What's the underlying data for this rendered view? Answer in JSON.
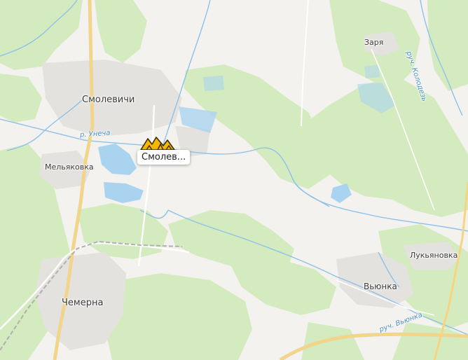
{
  "map": {
    "places": {
      "smolevichi": "Смолевичи",
      "melyakovka": "Мельяковка",
      "chemerna": "Чемерна",
      "zarya": "Заря",
      "vyunka": "Вьюнка",
      "lukyanovka": "Лукьяновка"
    },
    "rivers": {
      "unecha": "р. Унеча",
      "kolodez": "руч. Колодезь",
      "vyunka": "руч. Вьюнка"
    },
    "marker": {
      "label": "Смолев...",
      "icon": "mine-icon",
      "color": "#f5b800"
    },
    "colors": {
      "land": "#f4f2ee",
      "forest": "#d4ebc0",
      "water": "#aad3ef",
      "road": "#f7d47f",
      "urban": "#e4e2de"
    }
  }
}
